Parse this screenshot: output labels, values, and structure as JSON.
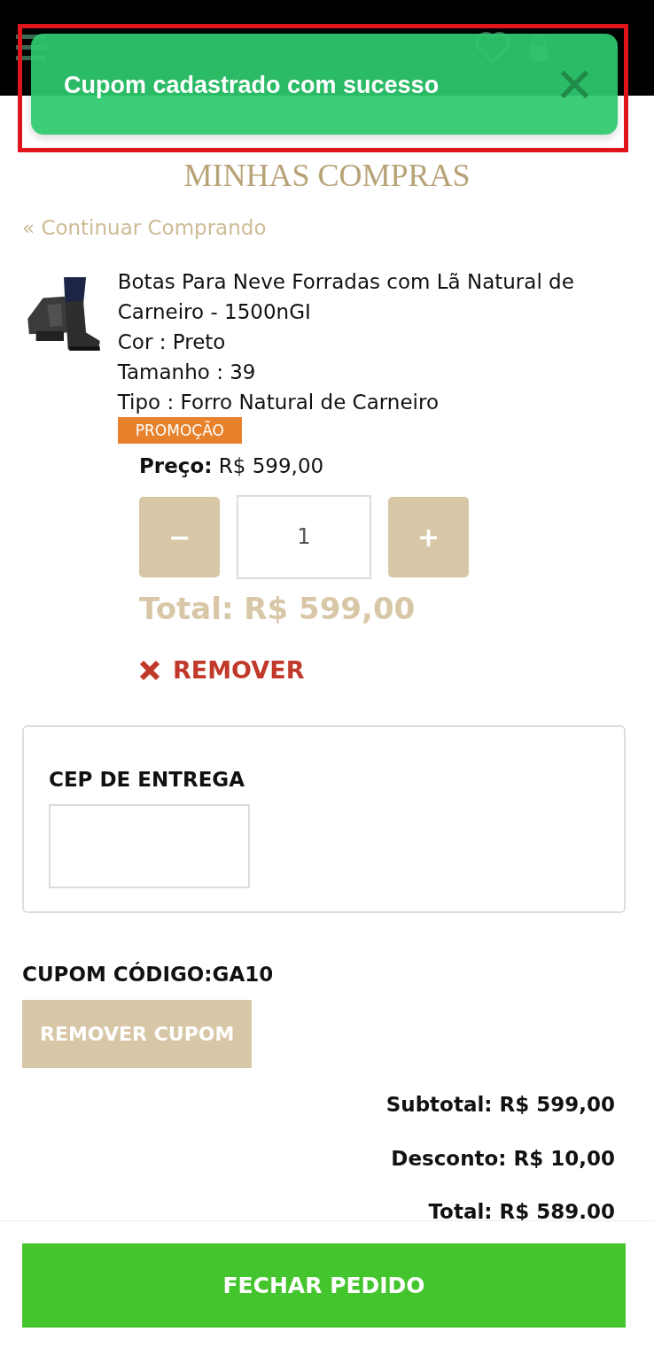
{
  "toast": {
    "message": "Cupom cadastrado com sucesso",
    "close": "✕",
    "highlighted": true
  },
  "page_title": "MINHAS COMPRAS",
  "continue_link": "« Continuar Comprando",
  "product": {
    "name": "Botas Para Neve Forradas com Lã Natural de Carneiro - 1500nGI",
    "attributes": [
      "Cor : Preto",
      "Tamanho : 39",
      "Tipo : Forro Natural de Carneiro"
    ],
    "tag": "PROMOÇÃO",
    "price_label": "Preço:",
    "price": "R$ 599,00",
    "quantity": {
      "minus": "−",
      "value": "1",
      "plus": "+"
    },
    "total": "Total: R$ 599,00",
    "remove": "REMOVER"
  },
  "shipping": {
    "label": "CEP DE ENTREGA"
  },
  "coupon": {
    "label": "CUPOM CÓDIGO:GA10",
    "button": "REMOVER CUPOM"
  },
  "summary": [
    {
      "label": "Subtotal:",
      "value": "R$ 599,00"
    },
    {
      "label": "Desconto:",
      "value": "R$ 10,00"
    },
    {
      "label": "Total:",
      "value": "R$ 589.00"
    }
  ],
  "checkout_button": "FECHAR PEDIDO"
}
